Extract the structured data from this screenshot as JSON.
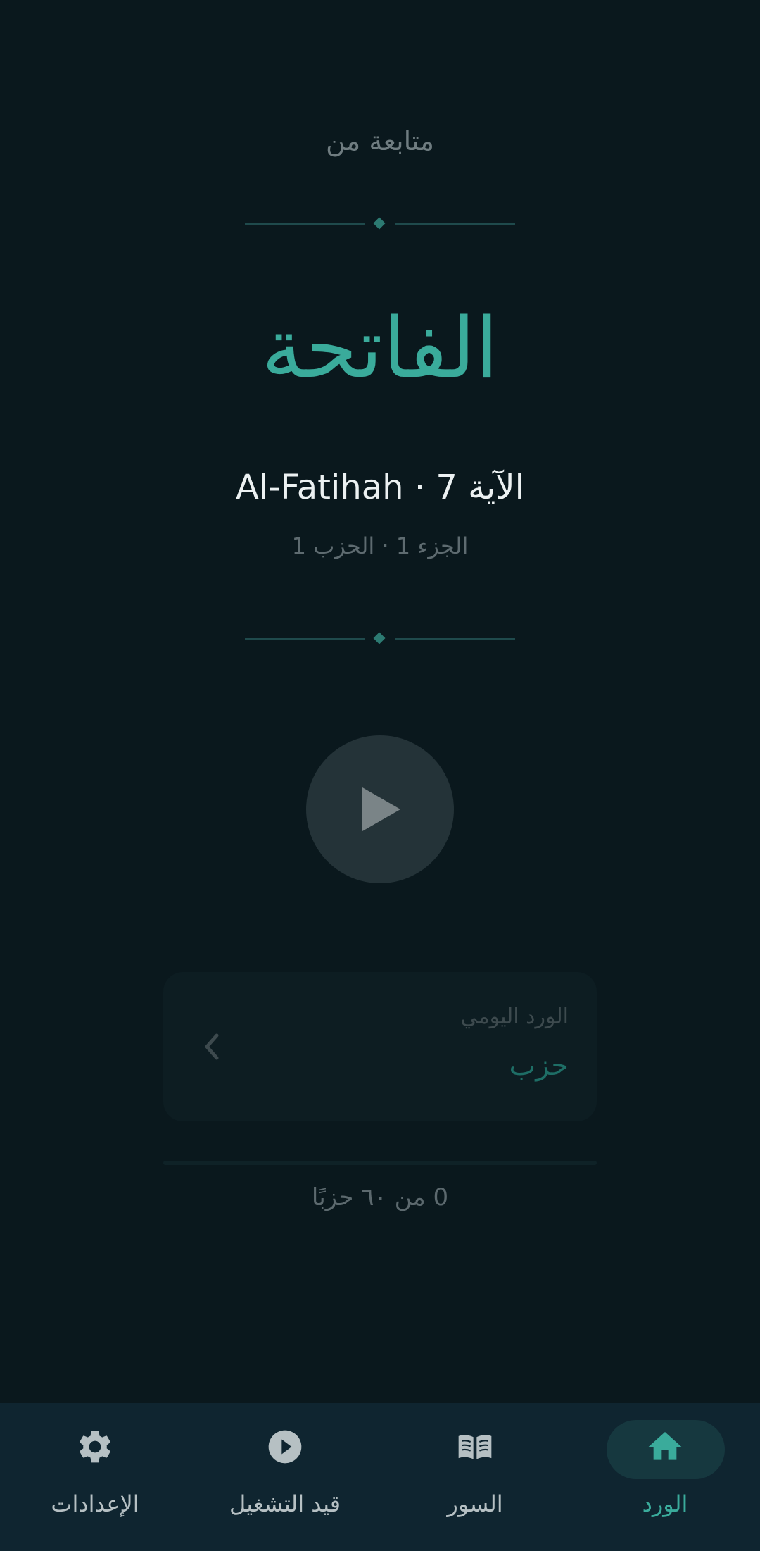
{
  "header": {
    "continue_label": "متابعة من"
  },
  "reading": {
    "surah_arabic": "الفاتحة",
    "surah_line": "Al-Fatihah · الآية 7",
    "juz_line": "الجزء 1 · الحزب 1"
  },
  "player": {
    "play_icon": "play-icon"
  },
  "daily_wird": {
    "title": "الورد اليومي",
    "value": "حزب",
    "chevron_icon": "chevron-left-icon"
  },
  "progress": {
    "text": "0 من ٦٠ حزبًا",
    "completed": 0,
    "total": 60
  },
  "bottom_nav": {
    "items": [
      {
        "label": "الورد",
        "icon": "home-icon",
        "active": true
      },
      {
        "label": "السور",
        "icon": "book-icon",
        "active": false
      },
      {
        "label": "قيد التشغيل",
        "icon": "play-circle-icon",
        "active": false
      },
      {
        "label": "الإعدادات",
        "icon": "gear-icon",
        "active": false
      }
    ]
  },
  "colors": {
    "background": "#0a181d",
    "accent": "#3aab9b",
    "nav_background": "#0f2530"
  }
}
